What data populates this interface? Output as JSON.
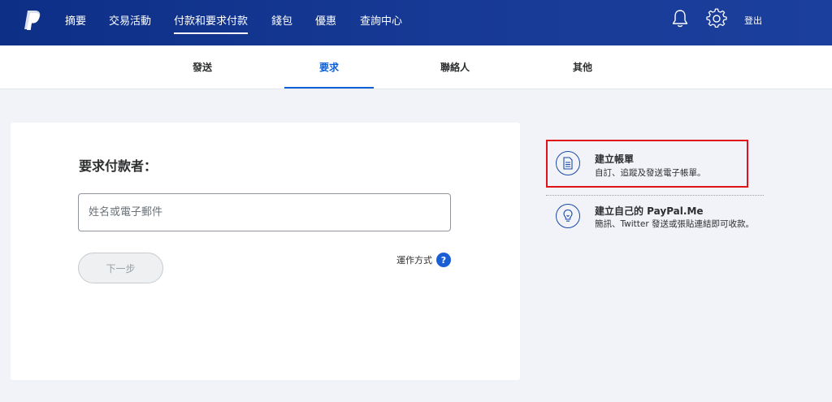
{
  "brand": {
    "logo_icon": "paypal-logo-icon"
  },
  "topnav": {
    "items": [
      "摘要",
      "交易活動",
      "付款和要求付款",
      "錢包",
      "優惠",
      "查詢中心"
    ],
    "active_index": 2,
    "notification_icon": "bell-icon",
    "settings_icon": "gear-icon",
    "logout_label": "登出"
  },
  "subtabs": {
    "items": [
      "發送",
      "要求",
      "聯絡人",
      "其他"
    ],
    "active_index": 1
  },
  "request_card": {
    "title": "要求付款者：",
    "input_placeholder": "姓名或電子郵件",
    "how_it_works_label": "運作方式",
    "help_glyph": "?",
    "next_button_label": "下一步"
  },
  "options": [
    {
      "icon": "document-icon",
      "title": "建立帳單",
      "description": "自訂、追蹤及發送電子帳單。"
    },
    {
      "icon": "lightbulb-icon",
      "title": "建立自己的 PayPal.Me",
      "description": "簡訊、Twitter 發送或張貼連結即可收款。"
    }
  ],
  "colors": {
    "nav_bg": "#0d2f86",
    "accent": "#0b5fd7",
    "highlight_border": "#e0131a",
    "page_bg": "#f1f3f8"
  }
}
